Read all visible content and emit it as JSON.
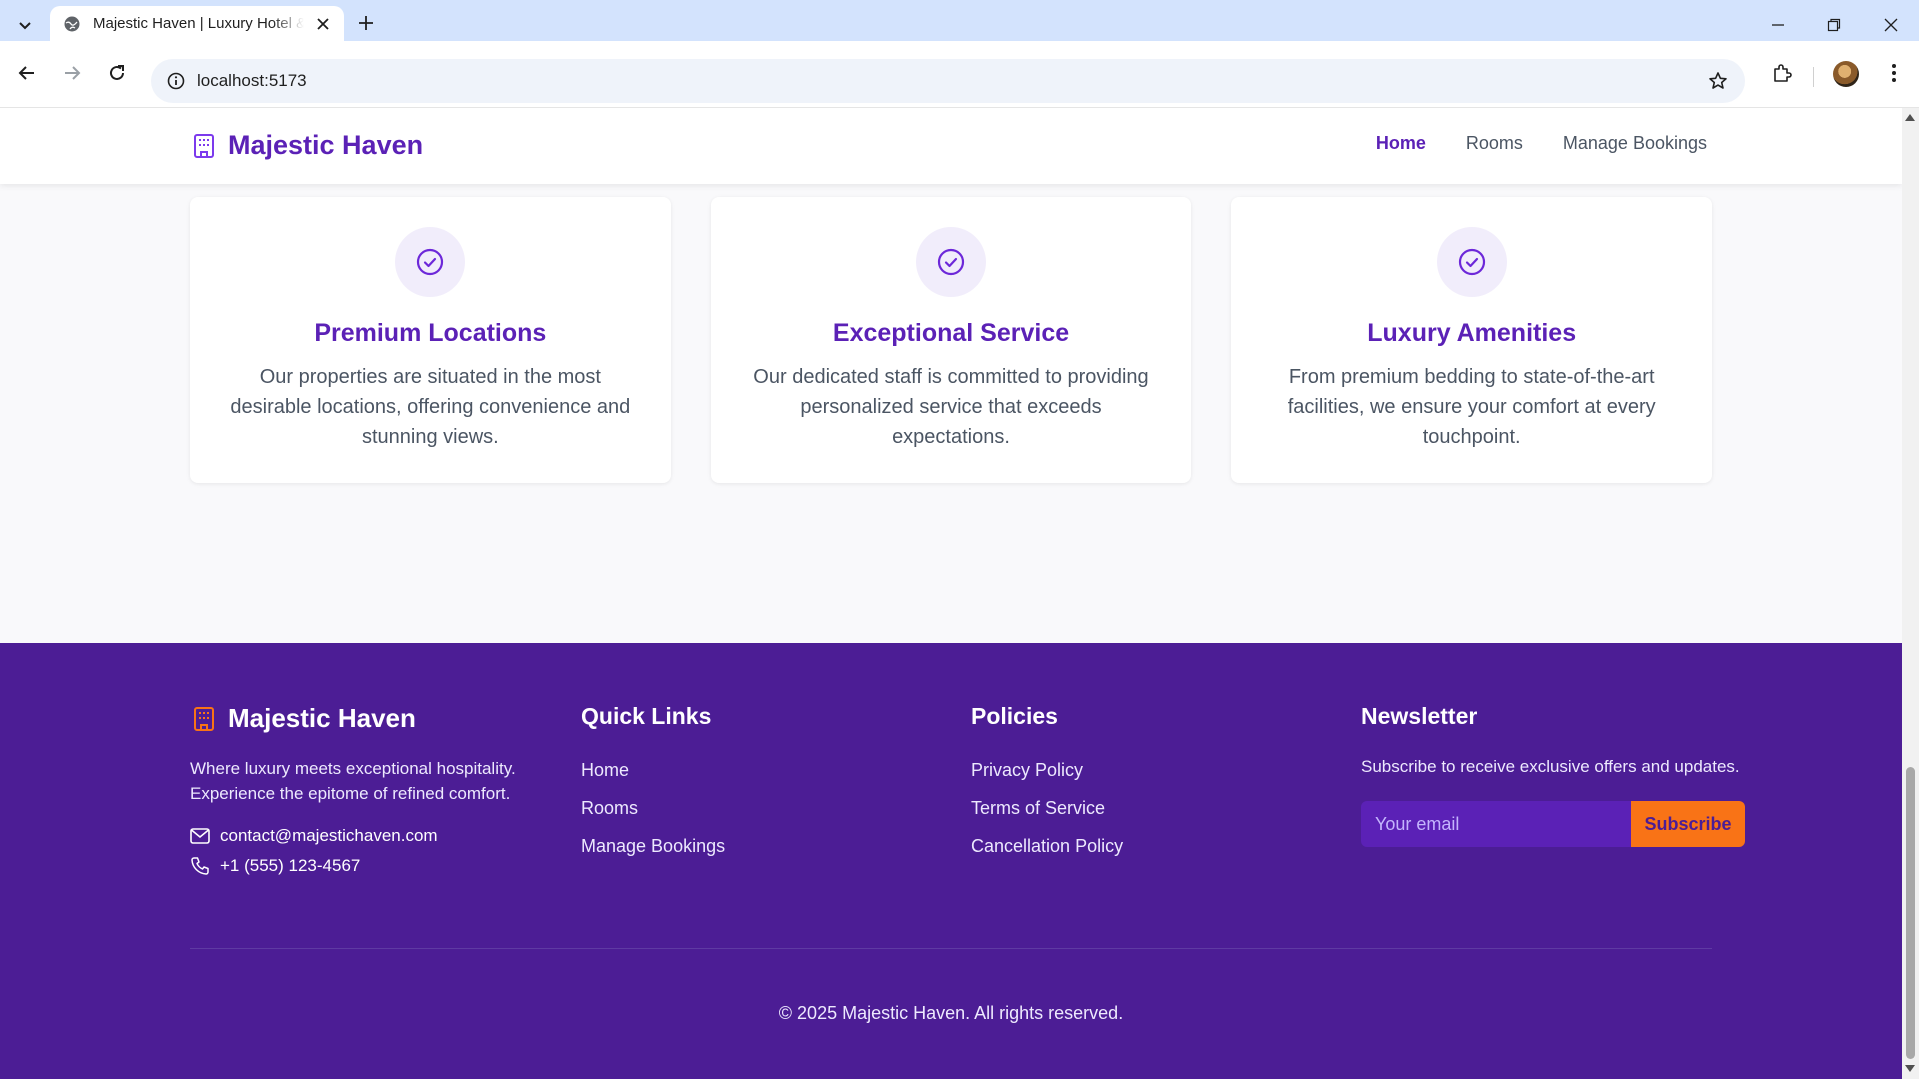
{
  "browser": {
    "tab_title": "Majestic Haven | Luxury Hotel & Resort",
    "url": "localhost:5173"
  },
  "colors": {
    "brand": "#5b21b6",
    "footer_bg": "#4c1d95",
    "accent": "#f97316"
  },
  "header": {
    "brand": "Majestic Haven",
    "nav": [
      {
        "label": "Home",
        "active": true
      },
      {
        "label": "Rooms",
        "active": false
      },
      {
        "label": "Manage Bookings",
        "active": false
      }
    ]
  },
  "features": [
    {
      "icon": "check-circle-icon",
      "title": "Premium Locations",
      "text": "Our properties are situated in the most desirable locations, offering convenience and stunning views."
    },
    {
      "icon": "check-circle-icon",
      "title": "Exceptional Service",
      "text": "Our dedicated staff is committed to providing personalized service that exceeds expectations."
    },
    {
      "icon": "check-circle-icon",
      "title": "Luxury Amenities",
      "text": "From premium bedding to state-of-the-art facilities, we ensure your comfort at every touchpoint."
    }
  ],
  "footer": {
    "brand": "Majestic Haven",
    "about": "Where luxury meets exceptional hospitality. Experience the epitome of refined comfort.",
    "email": "contact@majestichaven.com",
    "phone": "+1 (555) 123-4567",
    "quick_links": {
      "heading": "Quick Links",
      "links": [
        "Home",
        "Rooms",
        "Manage Bookings"
      ]
    },
    "policies": {
      "heading": "Policies",
      "links": [
        "Privacy Policy",
        "Terms of Service",
        "Cancellation Policy"
      ]
    },
    "newsletter": {
      "heading": "Newsletter",
      "text": "Subscribe to receive exclusive offers and updates.",
      "placeholder": "Your email",
      "button": "Subscribe"
    },
    "copyright": "© 2025 Majestic Haven. All rights reserved."
  }
}
